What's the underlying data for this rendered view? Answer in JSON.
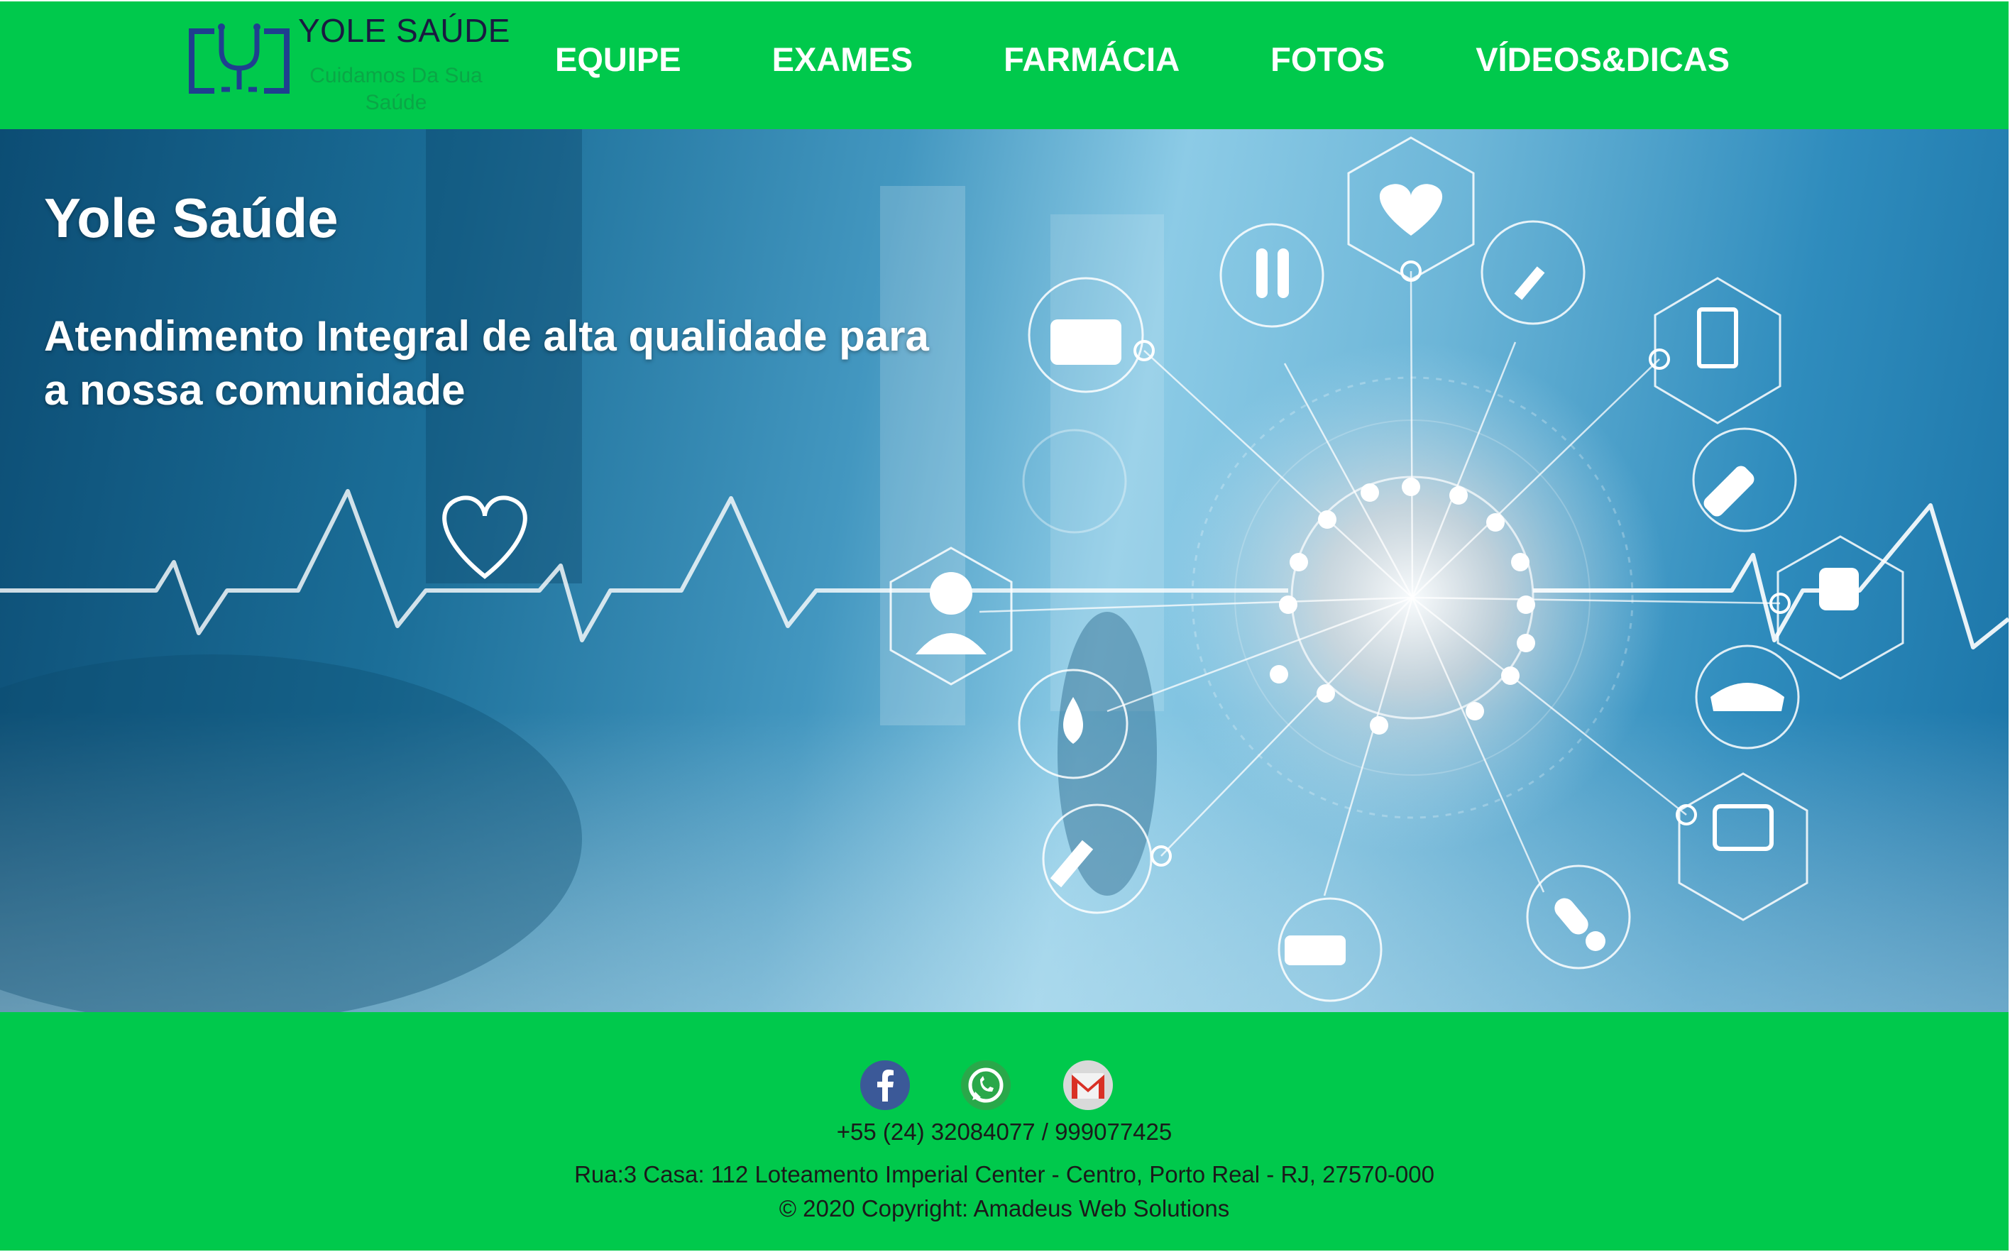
{
  "brand": {
    "title": "YOLE SAÚDE",
    "tagline": "Cuidamos Da Sua Saúde"
  },
  "nav": {
    "items": [
      {
        "label": "EQUIPE"
      },
      {
        "label": "EXAMES"
      },
      {
        "label": "FARMÁCIA"
      },
      {
        "label": "FOTOS"
      },
      {
        "label": "VÍDEOS&DICAS"
      }
    ]
  },
  "hero": {
    "title": "Yole Saúde",
    "subtitle": "Atendimento Integral de alta qualidade para a nossa comunidade"
  },
  "footer": {
    "social": [
      {
        "name": "facebook-icon"
      },
      {
        "name": "whatsapp-icon"
      },
      {
        "name": "gmail-icon"
      }
    ],
    "phone": "+55 (24) 32084077 / 999077425",
    "address": "Rua:3 Casa: 112 Loteamento Imperial Center - Centro, Porto Real - RJ, 27570-000",
    "copyright": "© 2020 Copyright: Amadeus Web Solutions"
  },
  "colors": {
    "header_bg": "#00c94c",
    "footer_bg": "#00c94c",
    "logo_blue": "#1f3f8f",
    "facebook": "#3b5998",
    "whatsapp": "#2aa84a",
    "gmail_red": "#d93025"
  }
}
